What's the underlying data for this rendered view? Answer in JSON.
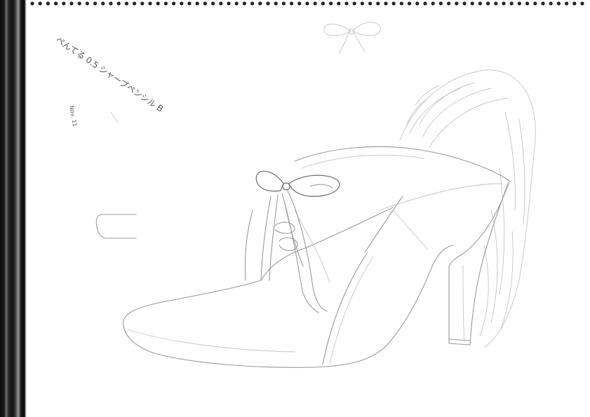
{
  "sketch": {
    "annotation_primary": "ぺんてる 0.5 シャープペンシル B",
    "annotation_secondary": "Nov. 11"
  },
  "colors": {
    "paper": "#ffffff",
    "binding": "#111111",
    "pencil_stroke": "#9a9a9a"
  }
}
